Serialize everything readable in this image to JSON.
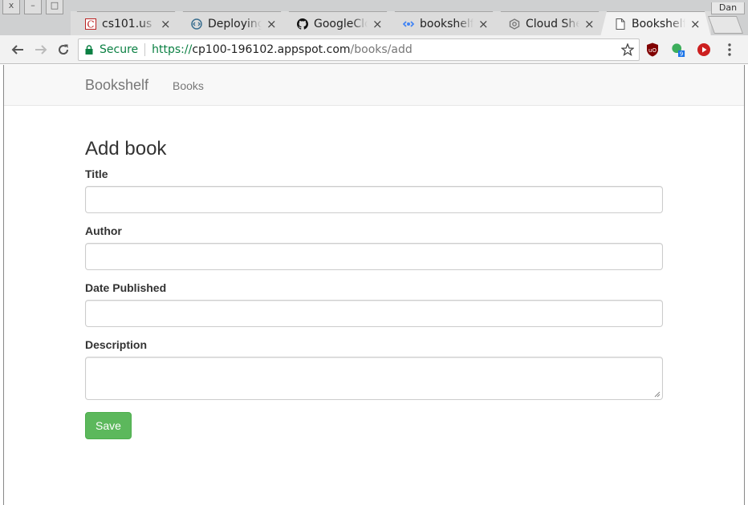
{
  "browser": {
    "window_controls": [
      "x",
      "–",
      "□"
    ],
    "profile_label": "Dan",
    "tabs": [
      {
        "title": "cs101.us",
        "icon": "cs101-favicon"
      },
      {
        "title": "Deploying",
        "icon": "code-favicon"
      },
      {
        "title": "GoogleClo",
        "icon": "github-icon"
      },
      {
        "title": "bookshelf",
        "icon": "cloud-source-favicon"
      },
      {
        "title": "Cloud Shel",
        "icon": "gcp-favicon"
      },
      {
        "title": "Bookshelf",
        "icon": "page-icon"
      }
    ],
    "active_tab": 5,
    "address_bar": {
      "secure_label": "Secure",
      "scheme": "https://",
      "host": "cp100-196102.appspot.com",
      "path": "/books/add"
    },
    "extensions": [
      {
        "name": "ublock-icon",
        "color": "#800000"
      },
      {
        "name": "green-dot-extension-icon",
        "color": "#3cae5b",
        "badge": "9"
      },
      {
        "name": "youtube-extension-icon",
        "color": "#cc1f1f"
      }
    ]
  },
  "navbar": {
    "brand": "Bookshelf",
    "links": [
      "Books"
    ]
  },
  "form": {
    "heading": "Add book",
    "fields": {
      "title": {
        "label": "Title",
        "value": ""
      },
      "author": {
        "label": "Author",
        "value": ""
      },
      "date_published": {
        "label": "Date Published",
        "value": ""
      },
      "description": {
        "label": "Description",
        "value": ""
      }
    },
    "save_label": "Save"
  },
  "colors": {
    "save_button": "#5cb85c",
    "secure_green": "#0b8043",
    "navbar_bg": "#f8f8f8"
  }
}
